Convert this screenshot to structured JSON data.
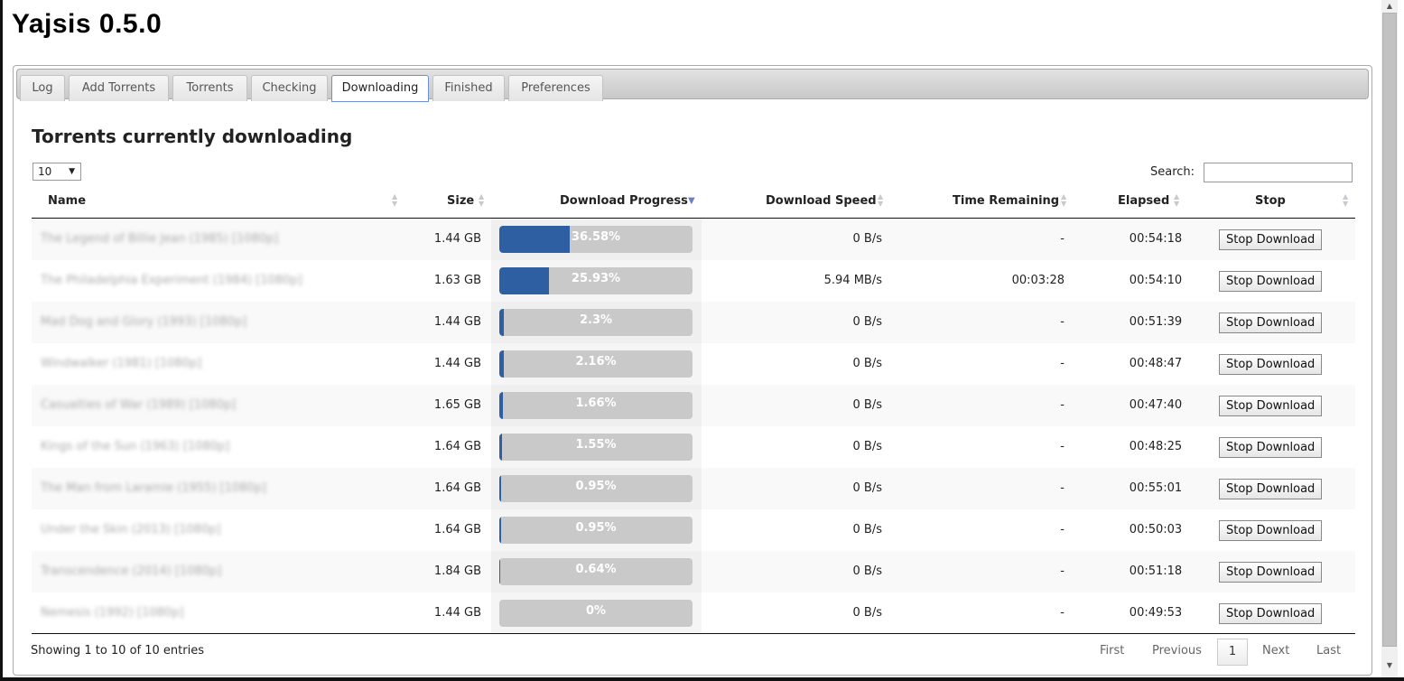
{
  "app": {
    "title": "Yajsis 0.5.0"
  },
  "tabs": [
    {
      "label": "Log",
      "active": false
    },
    {
      "label": "Add Torrents",
      "active": false
    },
    {
      "label": "Torrents",
      "active": false
    },
    {
      "label": "Checking",
      "active": false
    },
    {
      "label": "Downloading",
      "active": true
    },
    {
      "label": "Finished",
      "active": false
    },
    {
      "label": "Preferences",
      "active": false
    }
  ],
  "section_title": "Torrents currently downloading",
  "length_select": {
    "value": "10"
  },
  "search": {
    "label": "Search:",
    "value": ""
  },
  "columns": [
    "Name",
    "Size",
    "Download Progress",
    "Download Speed",
    "Time Remaining",
    "Elapsed",
    "Stop"
  ],
  "sorted_column": "Download Progress",
  "rows": [
    {
      "name": "The Legend of Billie Jean (1985) [1080p]",
      "size": "1.44 GB",
      "progress": 36.58,
      "progress_label": "36.58%",
      "speed": "0 B/s",
      "remaining": "-",
      "elapsed": "00:54:18",
      "stop_label": "Stop Download"
    },
    {
      "name": "The Philadelphia Experiment (1984) [1080p]",
      "size": "1.63 GB",
      "progress": 25.93,
      "progress_label": "25.93%",
      "speed": "5.94 MB/s",
      "remaining": "00:03:28",
      "elapsed": "00:54:10",
      "stop_label": "Stop Download"
    },
    {
      "name": "Mad Dog and Glory (1993) [1080p]",
      "size": "1.44 GB",
      "progress": 2.3,
      "progress_label": "2.3%",
      "speed": "0 B/s",
      "remaining": "-",
      "elapsed": "00:51:39",
      "stop_label": "Stop Download"
    },
    {
      "name": "Windwalker (1981) [1080p]",
      "size": "1.44 GB",
      "progress": 2.16,
      "progress_label": "2.16%",
      "speed": "0 B/s",
      "remaining": "-",
      "elapsed": "00:48:47",
      "stop_label": "Stop Download"
    },
    {
      "name": "Casualties of War (1989) [1080p]",
      "size": "1.65 GB",
      "progress": 1.66,
      "progress_label": "1.66%",
      "speed": "0 B/s",
      "remaining": "-",
      "elapsed": "00:47:40",
      "stop_label": "Stop Download"
    },
    {
      "name": "Kings of the Sun (1963) [1080p]",
      "size": "1.64 GB",
      "progress": 1.55,
      "progress_label": "1.55%",
      "speed": "0 B/s",
      "remaining": "-",
      "elapsed": "00:48:25",
      "stop_label": "Stop Download"
    },
    {
      "name": "The Man from Laramie (1955) [1080p]",
      "size": "1.64 GB",
      "progress": 0.95,
      "progress_label": "0.95%",
      "speed": "0 B/s",
      "remaining": "-",
      "elapsed": "00:55:01",
      "stop_label": "Stop Download"
    },
    {
      "name": "Under the Skin (2013) [1080p]",
      "size": "1.64 GB",
      "progress": 0.95,
      "progress_label": "0.95%",
      "speed": "0 B/s",
      "remaining": "-",
      "elapsed": "00:50:03",
      "stop_label": "Stop Download"
    },
    {
      "name": "Transcendence (2014) [1080p]",
      "size": "1.84 GB",
      "progress": 0.64,
      "progress_label": "0.64%",
      "speed": "0 B/s",
      "remaining": "-",
      "elapsed": "00:51:18",
      "stop_label": "Stop Download"
    },
    {
      "name": "Nemesis (1992) [1080p]",
      "size": "1.44 GB",
      "progress": 0,
      "progress_label": "0%",
      "speed": "0 B/s",
      "remaining": "-",
      "elapsed": "00:49:53",
      "stop_label": "Stop Download"
    }
  ],
  "footer": {
    "info": "Showing 1 to 10 of 10 entries",
    "first": "First",
    "previous": "Previous",
    "current_page": "1",
    "next": "Next",
    "last": "Last"
  },
  "colors": {
    "progress_fill": "#2e5fa3",
    "progress_track": "#c9c9c9",
    "active_tab_border": "#6e8fd6"
  }
}
